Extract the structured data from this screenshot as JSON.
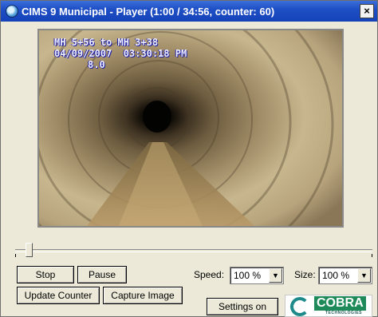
{
  "window": {
    "title": "CIMS 9 Municipal - Player (1:00 / 34:56, counter: 60)",
    "close_label": "×"
  },
  "video": {
    "overlay_line1": "MH 5+56 to MH 3+38",
    "overlay_line2": "04/09/2007  03:30:18 PM",
    "overlay_line3": "8.0"
  },
  "playback": {
    "progress_fraction": 0.0286
  },
  "controls": {
    "stop_label": "Stop",
    "pause_label": "Pause",
    "update_counter_label": "Update Counter",
    "capture_image_label": "Capture Image",
    "settings_label": "Settings on",
    "speed_label": "Speed:",
    "speed_value": "100 %",
    "size_label": "Size:",
    "size_value": "100 %",
    "dropdown_arrow": "▼"
  },
  "logo": {
    "main": "COBRA",
    "sub": "TECHNOLOGIES"
  },
  "icons": {
    "app": "app-globe-icon",
    "close": "close-icon",
    "dropdown": "dropdown-arrow-icon"
  },
  "colors": {
    "titlebar": "#1f4fc6",
    "dialog_bg": "#ece9d8",
    "logo_green": "#1e8a5a"
  }
}
